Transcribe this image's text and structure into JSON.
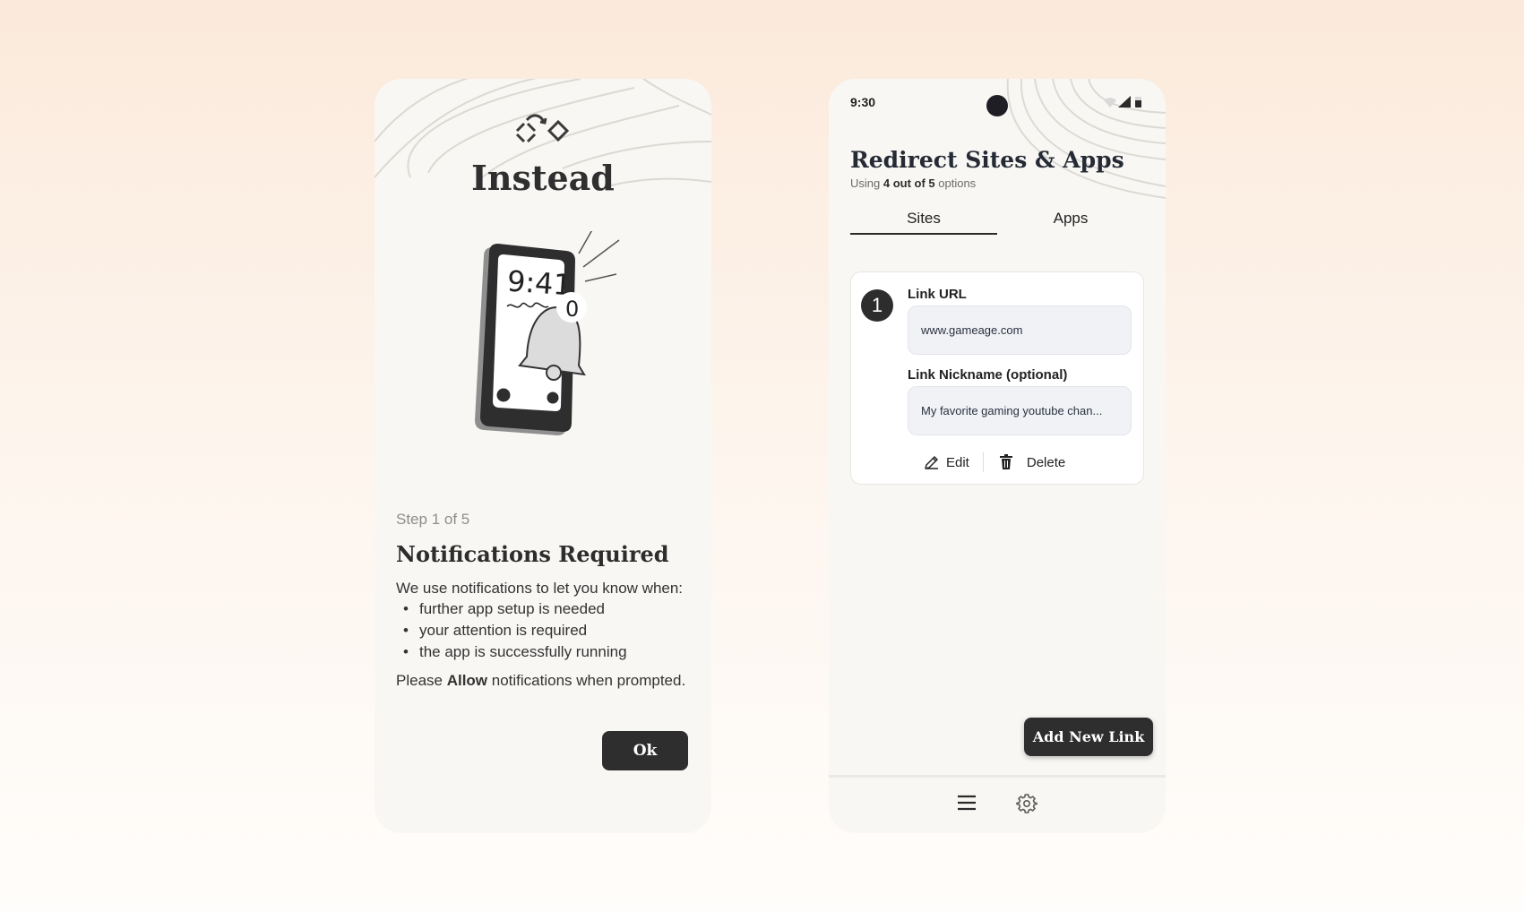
{
  "left_screen": {
    "brand_name": "Instead",
    "hero_clock": "9:41",
    "hero_badge": "0",
    "step_label": "Step 1 of 5",
    "title": "Notifications Required",
    "intro": "We use notifications to let you know when:",
    "bullets": [
      "further app setup is needed",
      "your attention is required",
      "the app is successfully running"
    ],
    "prompt": {
      "before": "Please ",
      "bold": "Allow",
      "after": " notifications when prompted."
    },
    "ok_label": "Ok"
  },
  "right_screen": {
    "status_time": "9:30",
    "title": "Redirect Sites & Apps",
    "usage": {
      "prefix": "Using ",
      "bold": "4 out of 5",
      "suffix": " options"
    },
    "tabs": [
      "Sites",
      "Apps"
    ],
    "active_tab": "Sites",
    "link_card": {
      "number": "1",
      "url_label": "Link URL",
      "url_value": "www.gameage.com",
      "nickname_label": "Link Nickname (optional)",
      "nickname_value": "My favorite gaming youtube chan...",
      "edit_label": "Edit",
      "delete_label": "Delete"
    },
    "add_button_label": "Add New Link",
    "nav_icons": [
      "menu-icon",
      "settings-gear-icon"
    ]
  },
  "colors": {
    "page_gradient_top": "#fbeadb",
    "card_bg": "#f8f7f4",
    "button_dark": "#2e2e2e",
    "field_bg": "#f1f2f6"
  }
}
